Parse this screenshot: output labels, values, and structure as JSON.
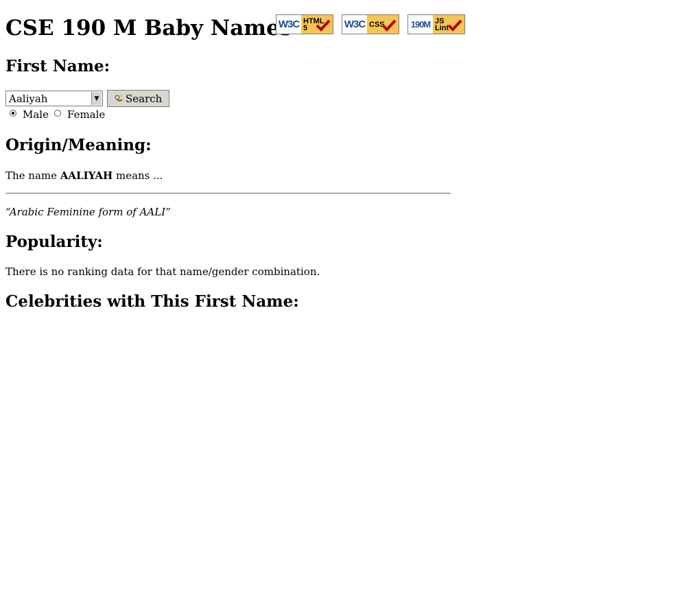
{
  "header": {
    "title": "CSE 190 M Baby Names",
    "badges": [
      {
        "left": "W3C",
        "right_top": "HTML",
        "right_bottom": "5",
        "icon": "w3c-html5-valid-badge-icon"
      },
      {
        "left": "W3C",
        "right_top": "CSS",
        "right_bottom": "",
        "icon": "w3c-css-valid-badge-icon"
      },
      {
        "left": "190M",
        "right_top": "JS",
        "right_bottom": "Lint",
        "icon": "jslint-badge-icon"
      }
    ]
  },
  "first_name": {
    "heading": "First Name:",
    "selected_name": "Aaliyah",
    "search_label": "Search",
    "gender_options": [
      {
        "label": "Male",
        "checked": true
      },
      {
        "label": "Female",
        "checked": false
      }
    ]
  },
  "origin": {
    "heading": "Origin/Meaning:",
    "prefix": "The name ",
    "name_upper": "AALIYAH",
    "suffix": " means ...",
    "meaning": "“Arabic Feminine form of AALI”"
  },
  "popularity": {
    "heading": "Popularity:",
    "message": "There is no ranking data for that name/gender combination."
  },
  "celebrities": {
    "heading": "Celebrities with This First Name:"
  },
  "colors": {
    "badge_yellow": "#f6c453",
    "badge_blue": "#1d4f91",
    "check_red": "#b30000",
    "button_gray": "#d9d6d0"
  }
}
